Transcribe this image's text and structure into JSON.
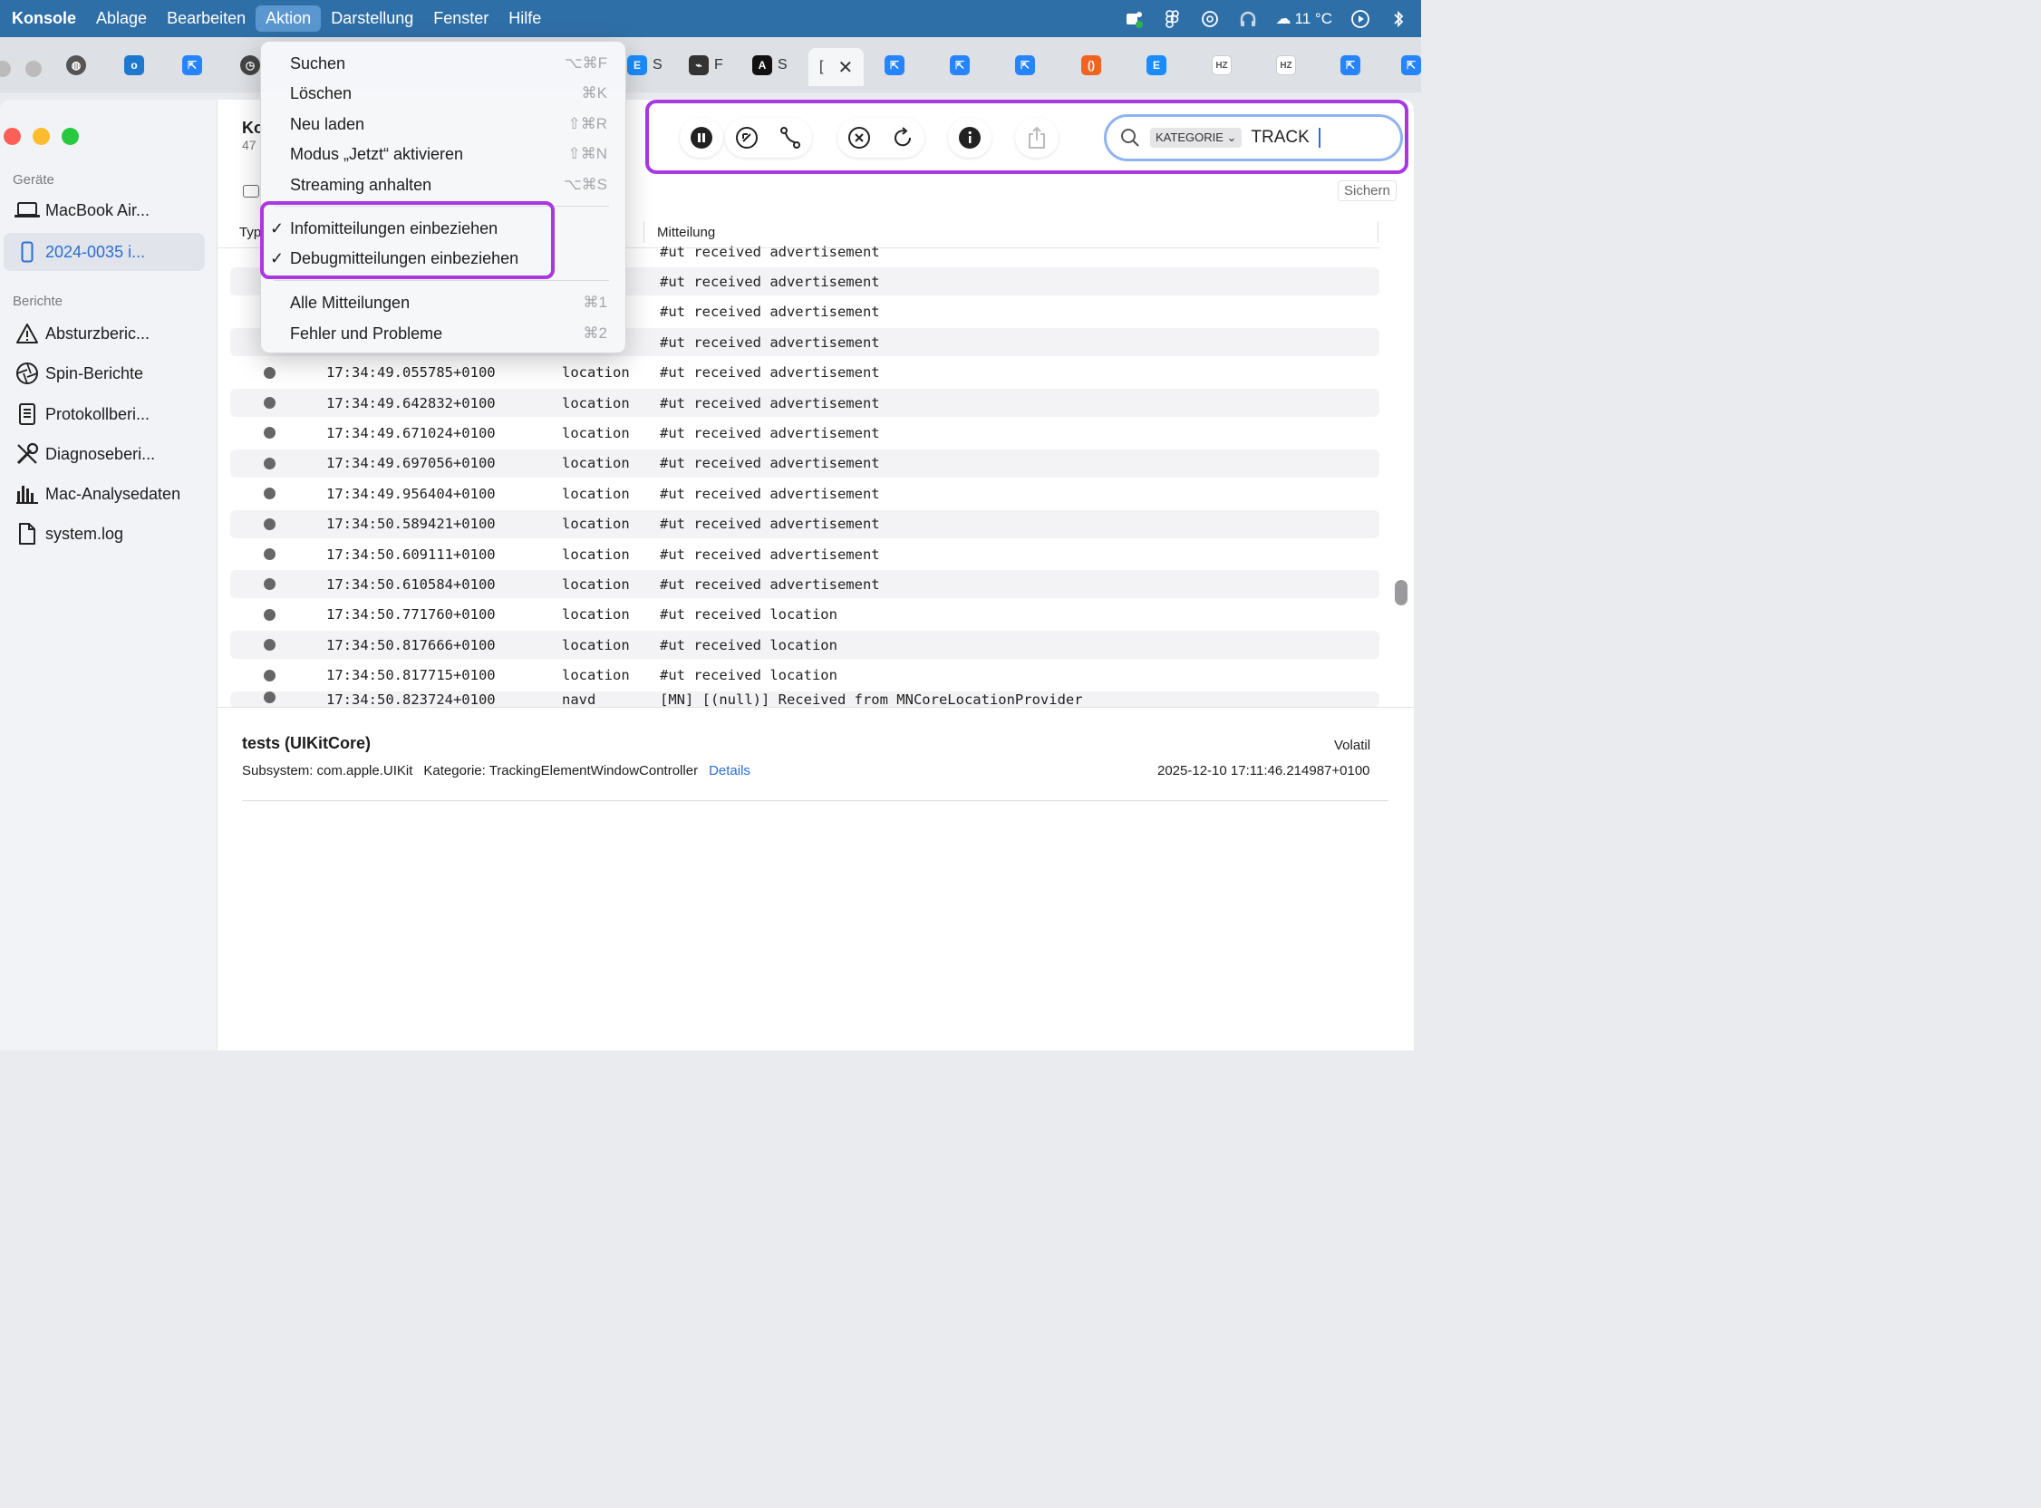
{
  "menubar": {
    "app": "Konsole",
    "items": [
      "Ablage",
      "Bearbeiten",
      "Aktion",
      "Darstellung",
      "Fenster",
      "Hilfe"
    ],
    "active": "Aktion",
    "weather": "11 °C"
  },
  "tabs": [
    {
      "letter": "E",
      "color": "#1a8cff"
    },
    {
      "letter": "S",
      "color": "#444"
    },
    {
      "letter": "F",
      "color": "#555"
    },
    {
      "letter": "A",
      "color": "#111"
    },
    {
      "letter": "[",
      "color": "#222"
    }
  ],
  "sidebar": {
    "devices_header": "Geräte",
    "devices": [
      "MacBook Air...",
      "2024-0035 i..."
    ],
    "reports_header": "Berichte",
    "reports": [
      "Absturzberic...",
      "Spin-Berichte",
      "Protokollberi...",
      "Diagnoseberi...",
      "Mac-Analysedaten",
      "system.log"
    ]
  },
  "main": {
    "title": "Ko",
    "subtitle": "47"
  },
  "toolbar": {
    "search": {
      "chip": "KATEGORIE ⌄",
      "token": "TRACK"
    },
    "save_label": "Sichern"
  },
  "columns": {
    "type": "Typ",
    "message": "Mitteilung"
  },
  "log_rows": [
    {
      "ts": "",
      "proc": "",
      "msg": "#ut received advertisement"
    },
    {
      "ts": "",
      "proc": "",
      "msg": "#ut received advertisement"
    },
    {
      "ts": "",
      "proc": "",
      "msg": "#ut received advertisement"
    },
    {
      "ts": "",
      "proc": "",
      "msg": "#ut received advertisement"
    },
    {
      "ts": "17:34:49.055785+0100",
      "proc": "location",
      "msg": "#ut received advertisement"
    },
    {
      "ts": "17:34:49.642832+0100",
      "proc": "location",
      "msg": "#ut received advertisement"
    },
    {
      "ts": "17:34:49.671024+0100",
      "proc": "location",
      "msg": "#ut received advertisement"
    },
    {
      "ts": "17:34:49.697056+0100",
      "proc": "location",
      "msg": "#ut received advertisement"
    },
    {
      "ts": "17:34:49.956404+0100",
      "proc": "location",
      "msg": "#ut received advertisement"
    },
    {
      "ts": "17:34:50.589421+0100",
      "proc": "location",
      "msg": "#ut received advertisement"
    },
    {
      "ts": "17:34:50.609111+0100",
      "proc": "location",
      "msg": "#ut received advertisement"
    },
    {
      "ts": "17:34:50.610584+0100",
      "proc": "location",
      "msg": "#ut received advertisement"
    },
    {
      "ts": "17:34:50.771760+0100",
      "proc": "location",
      "msg": "#ut received location"
    },
    {
      "ts": "17:34:50.817666+0100",
      "proc": "location",
      "msg": "#ut received location"
    },
    {
      "ts": "17:34:50.817715+0100",
      "proc": "location",
      "msg": "#ut received location"
    },
    {
      "ts": "17:34:50.823724+0100",
      "proc": "navd",
      "msg": "[MN] [(null)] Received from MNCoreLocationProvider"
    }
  ],
  "detail": {
    "title": "tests (UIKitCore)",
    "subsystem": "Subsystem: com.apple.UIKit",
    "category": "Kategorie: TrackingElementWindowController",
    "details_link": "Details",
    "volatility": "Volatil",
    "timestamp": "2025-12-10 17:11:46.214987+0100"
  },
  "action_menu": {
    "items": [
      {
        "label": "Suchen",
        "shortcut": "⌥⌘F"
      },
      {
        "label": "Löschen",
        "shortcut": "⌘K"
      },
      {
        "label": "Neu laden",
        "shortcut": "⇧⌘R"
      },
      {
        "label": "Modus „Jetzt“ aktivieren",
        "shortcut": "⇧⌘N"
      },
      {
        "label": "Streaming anhalten",
        "shortcut": "⌥⌘S"
      },
      {
        "label": "Infomitteilungen einbeziehen",
        "checked": true
      },
      {
        "label": "Debugmitteilungen einbeziehen",
        "checked": true
      },
      {
        "label": "Alle Mitteilungen",
        "shortcut": "⌘1"
      },
      {
        "label": "Fehler und Probleme",
        "shortcut": "⌘2"
      }
    ],
    "check_glyph": "✓"
  },
  "colors": {
    "menubar": "#2f6fa8",
    "highlight": "#a838e0",
    "accent": "#2a6ed3"
  }
}
